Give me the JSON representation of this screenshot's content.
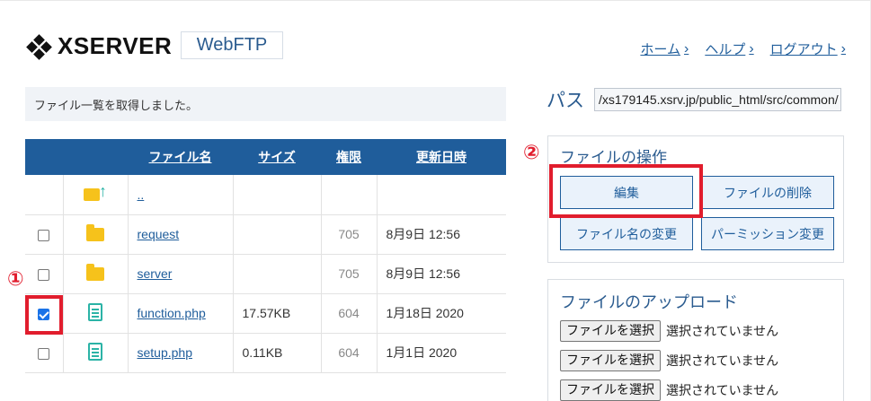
{
  "header": {
    "logo_text": "XSERVER",
    "app_name": "WebFTP",
    "nav": [
      {
        "label": "ホーム"
      },
      {
        "label": "ヘルプ"
      },
      {
        "label": "ログアウト"
      }
    ]
  },
  "status_message": "ファイル一覧を取得しました。",
  "table": {
    "headers": {
      "name": "ファイル名",
      "size": "サイズ",
      "perm": "権限",
      "date": "更新日時"
    },
    "rows": [
      {
        "type": "parent",
        "name": "..",
        "size": "",
        "perm": "",
        "date": "",
        "checked": false
      },
      {
        "type": "folder",
        "name": "request",
        "size": "",
        "perm": "705",
        "date": "8月9日 12:56",
        "checked": false
      },
      {
        "type": "folder",
        "name": "server",
        "size": "",
        "perm": "705",
        "date": "8月9日 12:56",
        "checked": false
      },
      {
        "type": "file",
        "name": "function.php",
        "size": "17.57KB",
        "perm": "604",
        "date": "1月18日 2020",
        "checked": true
      },
      {
        "type": "file",
        "name": "setup.php",
        "size": "0.11KB",
        "perm": "604",
        "date": "1月1日 2020",
        "checked": false
      }
    ]
  },
  "path": {
    "label": "パス",
    "value": "/xs179145.xsrv.jp/public_html/src/common/"
  },
  "file_ops": {
    "title": "ファイルの操作",
    "edit": "編集",
    "delete": "ファイルの削除",
    "rename": "ファイル名の変更",
    "permission": "パーミッション変更"
  },
  "upload": {
    "title": "ファイルのアップロード",
    "choose_label": "ファイルを選択",
    "no_file": "選択されていません"
  },
  "annotations": {
    "marker_1": "①",
    "marker_2": "②",
    "accent": "#e11d2d"
  },
  "colors": {
    "primary": "#1f5d9b",
    "folder": "#f6c21b",
    "file": "#2bb3a6"
  }
}
